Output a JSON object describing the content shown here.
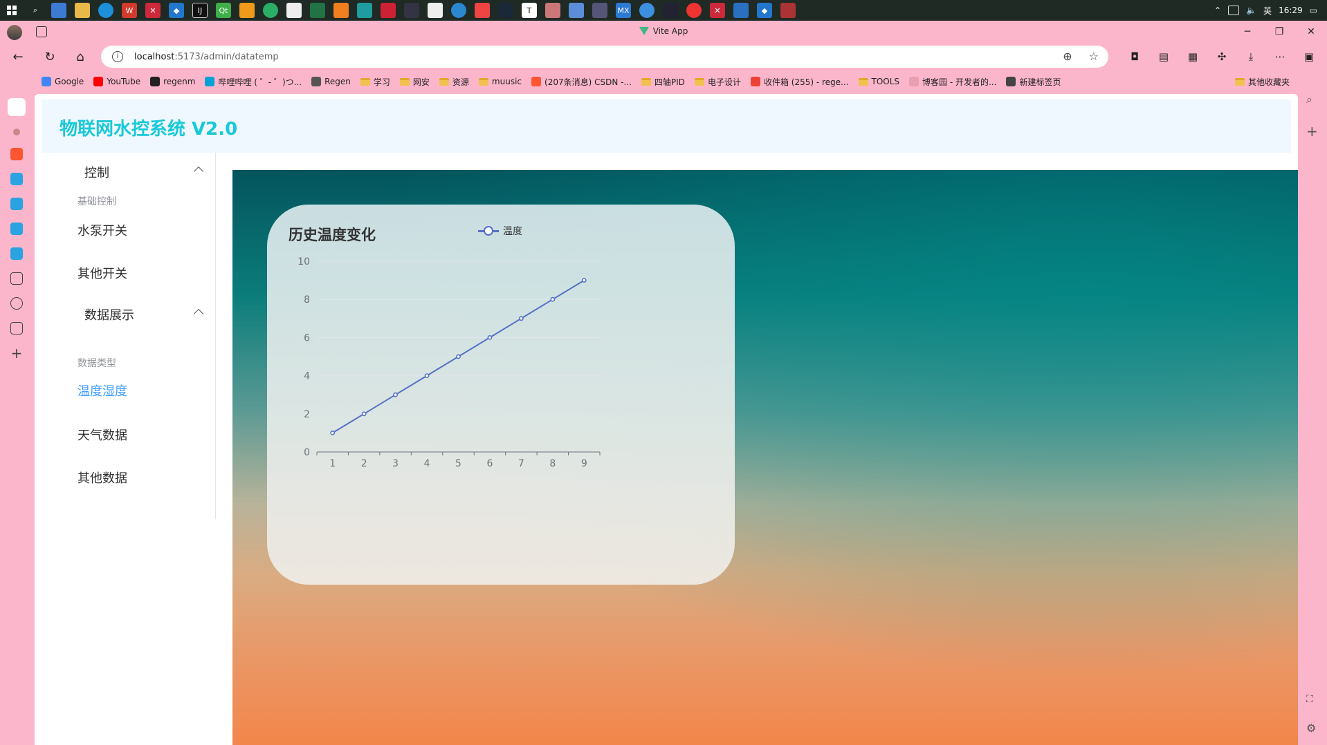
{
  "taskbar": {
    "time": "16:29",
    "ime": "英"
  },
  "browser": {
    "window_title": "Vite App",
    "url_host": "localhost",
    "url_rest": ":5173/admin/datatemp",
    "bookmarks": [
      {
        "label": "Google",
        "color": "#4285f4",
        "icon": "google-icon"
      },
      {
        "label": "YouTube",
        "color": "#ff0000",
        "icon": "youtube-icon"
      },
      {
        "label": "regenm",
        "color": "#222222",
        "icon": "github-icon"
      },
      {
        "label": "哔哩哔哩 ( ゜- ゜)つ...",
        "color": "#00a1d6",
        "icon": "bilibili-icon"
      },
      {
        "label": "Regen",
        "color": "#555555",
        "icon": "app-icon"
      },
      {
        "label": "学习",
        "color": "#f2c14e",
        "icon": "folder-icon"
      },
      {
        "label": "网安",
        "color": "#f2c14e",
        "icon": "folder-icon"
      },
      {
        "label": "资源",
        "color": "#f2c14e",
        "icon": "folder-icon"
      },
      {
        "label": "muusic",
        "color": "#f2c14e",
        "icon": "folder-icon"
      },
      {
        "label": "(207条消息) CSDN -...",
        "color": "#fc5531",
        "icon": "csdn-icon"
      },
      {
        "label": "四轴PID",
        "color": "#f2c14e",
        "icon": "folder-icon"
      },
      {
        "label": "电子设计",
        "color": "#f2c14e",
        "icon": "folder-icon"
      },
      {
        "label": "收件箱 (255) - rege...",
        "color": "#ea4335",
        "icon": "gmail-icon"
      },
      {
        "label": "TOOLS",
        "color": "#f2c14e",
        "icon": "folder-icon"
      },
      {
        "label": "博客园 - 开发者的...",
        "color": "#e8a0b0",
        "icon": "cnblogs-icon"
      },
      {
        "label": "新建标签页",
        "color": "#444444",
        "icon": "newtab-icon"
      }
    ],
    "other_bookmarks": "其他收藏夹"
  },
  "app": {
    "title": "物联网水控系统 V2.0"
  },
  "menu": {
    "group1": "控制",
    "section1": "基础控制",
    "item1": "水泵开关",
    "item2": "其他开关",
    "group2": "数据展示",
    "section2": "数据类型",
    "item3": "温度湿度",
    "item4": "天气数据",
    "item5": "其他数据"
  },
  "chart_data": {
    "type": "line",
    "title": "历史温度变化",
    "categories": [
      "1",
      "2",
      "3",
      "4",
      "5",
      "6",
      "7",
      "8",
      "9"
    ],
    "series": [
      {
        "name": "温度",
        "values": [
          1,
          2,
          3,
          4,
          5,
          6,
          7,
          8,
          9
        ],
        "color": "#5470c6"
      }
    ],
    "ylim": [
      0,
      10
    ],
    "yticks": [
      0,
      2,
      4,
      6,
      8,
      10
    ],
    "grid": true,
    "legend": "top-center"
  }
}
